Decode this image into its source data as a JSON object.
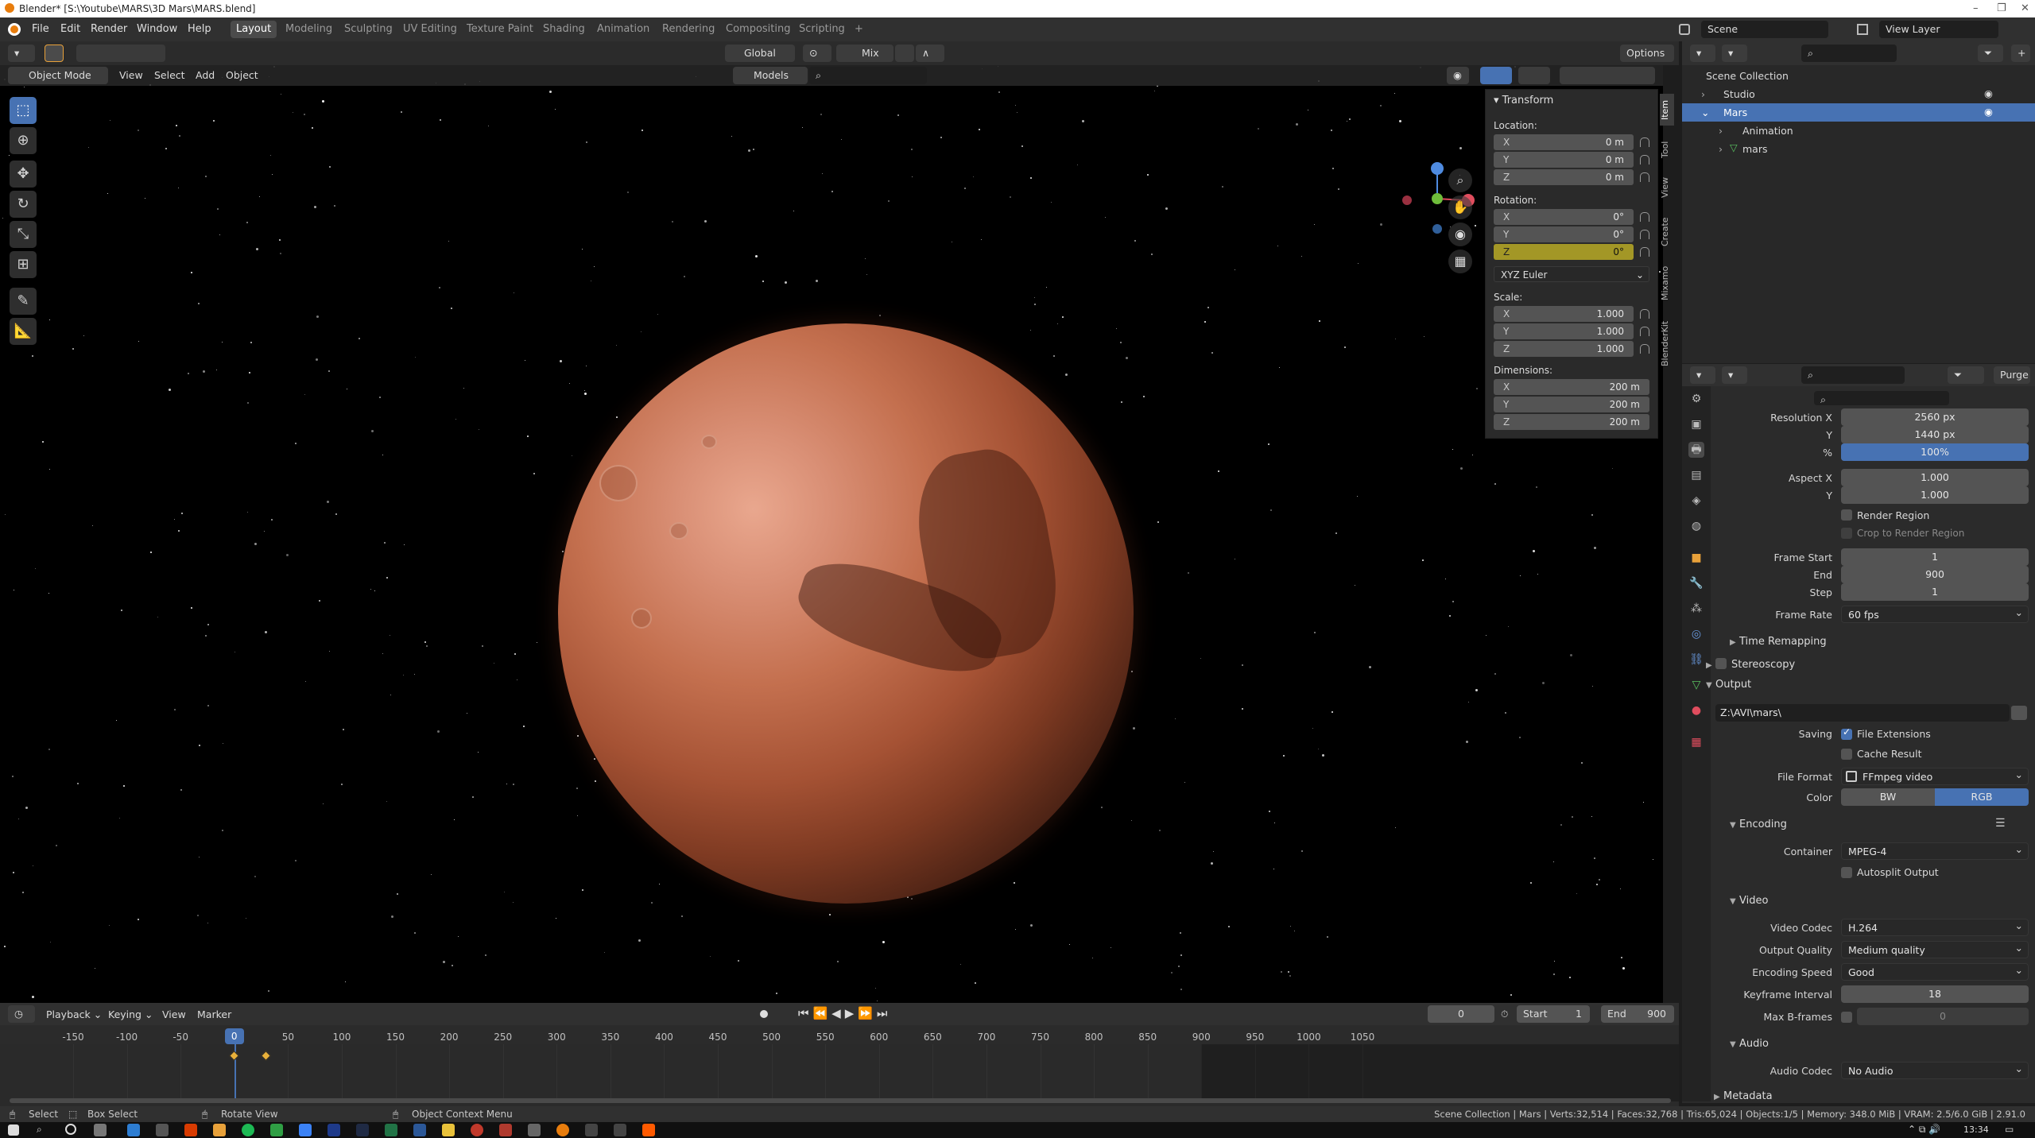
{
  "window": {
    "title": "Blender* [S:\\Youtube\\MARS\\3D Mars\\MARS.blend]",
    "controls": [
      "–",
      "❐",
      "✕"
    ]
  },
  "menu": [
    "File",
    "Edit",
    "Render",
    "Window",
    "Help"
  ],
  "workspaces": [
    {
      "label": "Layout",
      "active": true
    },
    {
      "label": "Modeling"
    },
    {
      "label": "Sculpting"
    },
    {
      "label": "UV Editing"
    },
    {
      "label": "Texture Paint"
    },
    {
      "label": "Shading"
    },
    {
      "label": "Animation"
    },
    {
      "label": "Rendering"
    },
    {
      "label": "Compositing"
    },
    {
      "label": "Scripting"
    },
    {
      "label": "+"
    }
  ],
  "scene_selector": {
    "label": "Scene"
  },
  "view_layer_selector": {
    "label": "View Layer"
  },
  "viewport_header": {
    "orientation": "Global",
    "pivot": "Mix",
    "options": "Options",
    "mode": "Object Mode",
    "menus": [
      "View",
      "Select",
      "Add",
      "Object"
    ],
    "collection_filter": "Models"
  },
  "transform_panel": {
    "title": "Transform",
    "location_label": "Location:",
    "location": [
      {
        "axis": "X",
        "value": "0 m"
      },
      {
        "axis": "Y",
        "value": "0 m"
      },
      {
        "axis": "Z",
        "value": "0 m"
      }
    ],
    "rotation_label": "Rotation:",
    "rotation": [
      {
        "axis": "X",
        "value": "0°"
      },
      {
        "axis": "Y",
        "value": "0°"
      },
      {
        "axis": "Z",
        "value": "0°"
      }
    ],
    "rotation_mode": "XYZ Euler",
    "scale_label": "Scale:",
    "scale": [
      {
        "axis": "X",
        "value": "1.000"
      },
      {
        "axis": "Y",
        "value": "1.000"
      },
      {
        "axis": "Z",
        "value": "1.000"
      }
    ],
    "dimensions_label": "Dimensions:",
    "dimensions": [
      {
        "axis": "X",
        "value": "200 m"
      },
      {
        "axis": "Y",
        "value": "200 m"
      },
      {
        "axis": "Z",
        "value": "200 m"
      }
    ]
  },
  "sidebar_tabs": [
    "Item",
    "Tool",
    "View",
    "Create",
    "Mixamo",
    "BlenderKit"
  ],
  "outliner": {
    "rows": [
      {
        "label": "Scene Collection",
        "indent": 0
      },
      {
        "label": "Studio",
        "indent": 1
      },
      {
        "label": "Mars",
        "indent": 1,
        "selected": true
      },
      {
        "label": "Animation",
        "indent": 2
      },
      {
        "label": "mars",
        "indent": 2
      }
    ]
  },
  "properties": {
    "purge": "Purge",
    "resolution_x_label": "Resolution X",
    "resolution_x": "2560 px",
    "resolution_y_label": "Y",
    "resolution_y": "1440 px",
    "percent_label": "%",
    "percent": "100%",
    "percent_fill": 1.0,
    "aspect_x_label": "Aspect X",
    "aspect_x": "1.000",
    "aspect_y_label": "Y",
    "aspect_y": "1.000",
    "render_region": "Render Region",
    "crop_region": "Crop to Render Region",
    "frame_start_label": "Frame Start",
    "frame_start": "1",
    "frame_end_label": "End",
    "frame_end": "900",
    "frame_step_label": "Step",
    "frame_step": "1",
    "frame_rate_label": "Frame Rate",
    "frame_rate": "60 fps",
    "time_remapping": "Time Remapping",
    "stereoscopy": "Stereoscopy",
    "output": "Output",
    "output_path": "Z:\\AVI\\mars\\",
    "saving_label": "Saving",
    "file_extensions": "File Extensions",
    "cache_result": "Cache Result",
    "file_format_label": "File Format",
    "file_format": "FFmpeg video",
    "color_label": "Color",
    "color_bw": "BW",
    "color_rgb": "RGB",
    "encoding": "Encoding",
    "container_label": "Container",
    "container": "MPEG-4",
    "autosplit": "Autosplit Output",
    "video": "Video",
    "video_codec_label": "Video Codec",
    "video_codec": "H.264",
    "output_quality_label": "Output Quality",
    "output_quality": "Medium quality",
    "encoding_speed_label": "Encoding Speed",
    "encoding_speed": "Good",
    "keyframe_interval_label": "Keyframe Interval",
    "keyframe_interval": "18",
    "max_bframes_label": "Max B-frames",
    "max_bframes": "0",
    "audio": "Audio",
    "audio_codec_label": "Audio Codec",
    "audio_codec": "No Audio",
    "metadata": "Metadata"
  },
  "timeline": {
    "menus": [
      "Playback",
      "Keying",
      "View",
      "Marker"
    ],
    "current_frame": "0",
    "start_label": "Start",
    "start": "1",
    "end_label": "End",
    "end": "900",
    "ticks": [
      "-150",
      "-100",
      "-50",
      "0",
      "50",
      "100",
      "150",
      "200",
      "250",
      "300",
      "350",
      "400",
      "450",
      "500",
      "550",
      "600",
      "650",
      "700",
      "750",
      "800",
      "850",
      "900",
      "950",
      "1000",
      "1050"
    ],
    "playhead_frame": 0,
    "keyframes": [
      0,
      30
    ]
  },
  "statusbar": {
    "select": "Select",
    "box_select": "Box Select",
    "rotate_view": "Rotate View",
    "context_menu": "Object Context Menu",
    "stats": "Scene Collection | Mars | Verts:32,514 | Faces:32,768 | Tris:65,024 | Objects:1/5 | Memory: 348.0 MiB | VRAM: 2.5/6.0 GiB | 2.91.0"
  },
  "taskbar": {
    "time": "13:34"
  },
  "colors": {
    "accent": "#4772b3",
    "z_highlight": "#a39726",
    "planet": "#c4704f"
  }
}
